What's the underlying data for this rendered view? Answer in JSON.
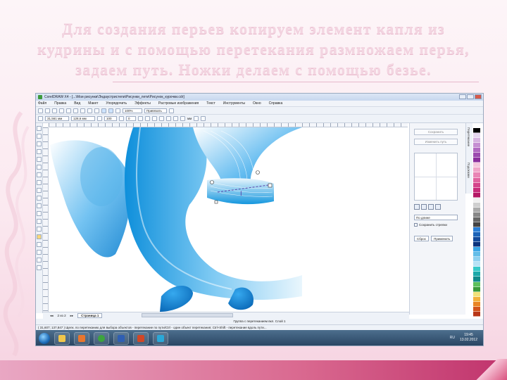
{
  "slide": {
    "title": "Для создания перьев копируем элемент капля из кудрины и с помощью перетекания размножаем перья, задаем путь. Ножки делаем с помощью безье."
  },
  "window": {
    "title": "CorelDRAW X4 - [...\\Мои рисунки\\Эндаустристепи\\Рисунки_лети\\Рисунок_курочки.cdr]"
  },
  "menu": [
    "Файл",
    "Правка",
    "Вид",
    "Макет",
    "Упорядочить",
    "Эффекты",
    "Растровые изображения",
    "Текст",
    "Инструменты",
    "Окно",
    "Справка"
  ],
  "toolbar": {
    "zoom": "100%",
    "snap": "Привязать",
    "units_label": "мм"
  },
  "propbar": {
    "x": "31,561 мм",
    "y": "128,6 мм",
    "field_a": "100",
    "field_b": "0"
  },
  "docker": {
    "btn_deselect": "Сохранить",
    "btn_current": "Изменить путь",
    "select": "По длине",
    "checkbox": "Сохранить стрелки",
    "apply": "Сброс",
    "apply2": "Применить",
    "tab1": "Перетекание",
    "tab2": "Подсказки"
  },
  "pages": {
    "counter": "2 из 2",
    "current": "Страница 1"
  },
  "status": {
    "line1": "Группа с перетеканием вкл. Слой 1",
    "line2": "( 31,607; 137,847 )    Щелк. по перетеканию для выбора объектов - перетекание по пути/Ctrl - один объект перетекания; Ctrl+Shift - перетекание вдоль пути..."
  },
  "clock": {
    "time": "19:45",
    "date": "13.02.2012"
  },
  "tray": "RU",
  "colors": {
    "accent_blue": "#1e90d6",
    "pink_band": "#d9688f",
    "palette": [
      "#ffffff",
      "#000000",
      "#e5d6ee",
      "#d6b3e0",
      "#c58fd2",
      "#b06ac1",
      "#9b4aaf",
      "#8a2f9d",
      "#f4c6dd",
      "#f0a6c9",
      "#e985b5",
      "#e064a0",
      "#d4448b",
      "#c72c7a",
      "#b31865",
      "#f0f0f0",
      "#cfcfcf",
      "#aaaaaa",
      "#888888",
      "#666666",
      "#444444",
      "#2a7ed6",
      "#1b63b8",
      "#12499a",
      "#0a337d",
      "#3aa6e6",
      "#62bde8",
      "#8ed1f0",
      "#b6e2f5",
      "#36c9c9",
      "#1ba9a9",
      "#108a8a",
      "#5cc05c",
      "#3a9a3a",
      "#f0e27a",
      "#f2b13c",
      "#e98524",
      "#d2531b",
      "#b83618"
    ]
  }
}
